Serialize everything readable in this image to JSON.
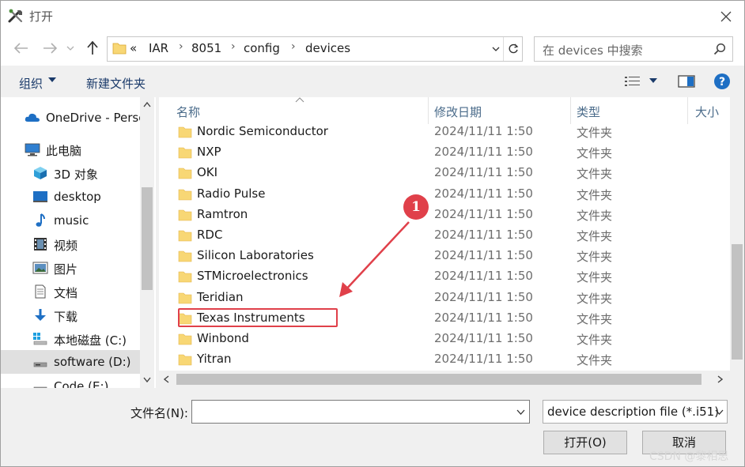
{
  "window": {
    "title": "打开"
  },
  "address": {
    "overflow": "«",
    "crumbs": [
      "IAR",
      "8051",
      "config",
      "devices"
    ]
  },
  "search": {
    "placeholder": "在 devices 中搜索"
  },
  "toolbar": {
    "organize": "组织",
    "new_folder": "新建文件夹"
  },
  "sidebar": {
    "items": [
      {
        "label": "OneDrive - Perso",
        "icon": "cloud-icon"
      },
      {
        "label": "此电脑",
        "icon": "computer-icon"
      },
      {
        "label": "3D 对象",
        "icon": "cube-icon"
      },
      {
        "label": "desktop",
        "icon": "desktop-icon"
      },
      {
        "label": "music",
        "icon": "music-note-icon"
      },
      {
        "label": "视频",
        "icon": "film-icon"
      },
      {
        "label": "图片",
        "icon": "picture-icon"
      },
      {
        "label": "文档",
        "icon": "document-icon"
      },
      {
        "label": "下载",
        "icon": "download-arrow-icon"
      },
      {
        "label": "本地磁盘 (C:)",
        "icon": "windows-drive-icon"
      },
      {
        "label": "software (D:)",
        "icon": "drive-icon"
      },
      {
        "label": "Code (E:)",
        "icon": "drive-icon"
      }
    ]
  },
  "columns": {
    "name": "名称",
    "date": "修改日期",
    "type": "类型",
    "size": "大小"
  },
  "files": [
    {
      "name": "Nordic Semiconductor",
      "date": "2024/11/11 1:50",
      "type": "文件夹"
    },
    {
      "name": "NXP",
      "date": "2024/11/11 1:50",
      "type": "文件夹"
    },
    {
      "name": "OKI",
      "date": "2024/11/11 1:50",
      "type": "文件夹"
    },
    {
      "name": "Radio Pulse",
      "date": "2024/11/11 1:50",
      "type": "文件夹"
    },
    {
      "name": "Ramtron",
      "date": "2024/11/11 1:50",
      "type": "文件夹"
    },
    {
      "name": "RDC",
      "date": "2024/11/11 1:50",
      "type": "文件夹"
    },
    {
      "name": "Silicon Laboratories",
      "date": "2024/11/11 1:50",
      "type": "文件夹"
    },
    {
      "name": "STMicroelectronics",
      "date": "2024/11/11 1:50",
      "type": "文件夹"
    },
    {
      "name": "Teridian",
      "date": "2024/11/11 1:50",
      "type": "文件夹"
    },
    {
      "name": "Texas Instruments",
      "date": "2024/11/11 1:50",
      "type": "文件夹"
    },
    {
      "name": "Winbond",
      "date": "2024/11/11 1:50",
      "type": "文件夹"
    },
    {
      "name": "Yitran",
      "date": "2024/11/11 1:50",
      "type": "文件夹"
    }
  ],
  "annotation": {
    "number": "1",
    "highlighted": "Texas Instruments",
    "color": "#e0404a"
  },
  "bottom": {
    "filename_label": "文件名(N):",
    "filename_value": "",
    "filetype": "device description file (*.i51)",
    "open_button": "打开(O)",
    "cancel_button": "取消"
  },
  "watermark": "CSDN @黎相思",
  "colors": {
    "folder": "#f8d775",
    "accent": "#0063b1",
    "help": "#1e6fc4"
  }
}
